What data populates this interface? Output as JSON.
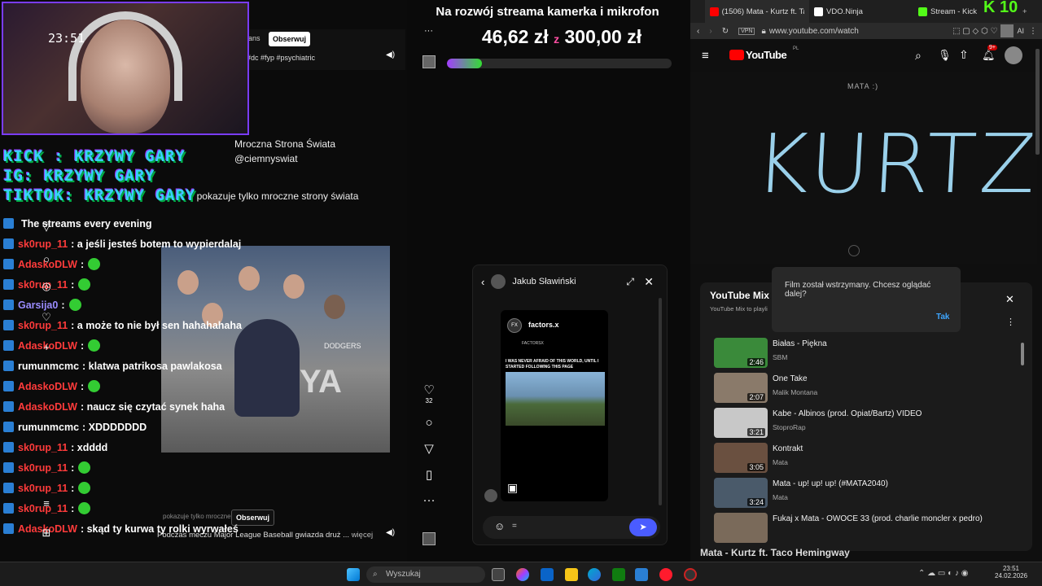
{
  "stream": {
    "webcam_clock": "23:51",
    "socials": [
      "KICK : KRZYWY GARY",
      "IG: KRZYWY GARY",
      "TIKTOK: KRZYWY GARY"
    ],
    "chat": [
      {
        "user": "",
        "text": "The streams every evening",
        "color": "#cccccc"
      },
      {
        "user": "sk0rup_11",
        "text": ": a jeśli jesteś botem to wypierdalaj",
        "color": "#ff3b3b"
      },
      {
        "user": "AdaskoDLW",
        "text": ":",
        "color": "#ff3b3b",
        "emote": true
      },
      {
        "user": "sk0rup_11",
        "text": ":",
        "color": "#ff3b3b",
        "emote": true
      },
      {
        "user": "Garsija0",
        "text": ":",
        "color": "#9a8cff",
        "emote": true
      },
      {
        "user": "sk0rup_11",
        "text": ": a może to nie był sen hahahahaha",
        "color": "#ff3b3b"
      },
      {
        "user": "AdaskoDLW",
        "text": ":",
        "color": "#ff3b3b",
        "emote": true
      },
      {
        "user": "rumunmcmc",
        "text": ": klatwa patrikosa pawlakosa",
        "color": "#ffffff"
      },
      {
        "user": "AdaskoDLW",
        "text": ":",
        "color": "#ff3b3b",
        "emote": true
      },
      {
        "user": "AdaskoDLW",
        "text": ": naucz się czytać synek haha",
        "color": "#ff3b3b"
      },
      {
        "user": "rumunmcmc",
        "text": ": XDDDDDDD",
        "color": "#ffffff"
      },
      {
        "user": "sk0rup_11",
        "text": ": xdddd",
        "color": "#ff3b3b"
      },
      {
        "user": "sk0rup_11",
        "text": ":",
        "color": "#ff3b3b",
        "emote": true
      },
      {
        "user": "sk0rup_11",
        "text": ":",
        "color": "#ff3b3b",
        "emote": true
      },
      {
        "user": "sk0rup_11",
        "text": ":",
        "color": "#ff3b3b",
        "emote": true
      },
      {
        "user": "AdaskoDLW",
        "text": ": skąd ty kurwa ty rolki wyrwałeś",
        "color": "#ff3b3b"
      }
    ]
  },
  "tiktok": {
    "top_partial": "ans",
    "follow_label": "Obserwuj",
    "top_tags": "#dc #fyp #psychiatric",
    "account_name": "Mroczna Strona Świata",
    "account_handle": "@ciemnyswiat",
    "account_bio": "pokazuje tylko mroczne strony świata",
    "video_brand": "DODGERS",
    "video_sign": "YA",
    "likes_count": "32",
    "caption": "Podczas meczu Major League Baseball gwiazda druż ...",
    "more_label": "więcej",
    "bottom_user": "pokazuje tylko mroczne"
  },
  "goal": {
    "title": "Na rozwój streama kamerka i mikrofon",
    "current": "46,62 zł",
    "separator": "z",
    "target": "300,00 zł",
    "progress": 0.155
  },
  "dm": {
    "contact": "Jakub Sławiński",
    "card_brand": "factors.x",
    "card_sub": "FACTORSX",
    "card_text": "I WAS NEVER AFRAID OF THIS WORLD, UNTIL I STARTED FOLLOWING THIS PAGE",
    "input_value": "="
  },
  "browser": {
    "tabs": [
      {
        "label": "(1506) Mata - Kurtz ft. Ta",
        "color": "#ff0000",
        "active": true
      },
      {
        "label": "VDO.Ninja",
        "color": "#ffffff",
        "active": false
      },
      {
        "label": "Stream - Kick",
        "color": "#53fc18",
        "active": false
      }
    ],
    "url": "www.youtube.com/watch",
    "vpn_label": "VPN",
    "ai_label": "AI",
    "yt_logo": "YouTube",
    "yt_region": "PL",
    "notif_count": "9+",
    "video_small_text": "MATA :)",
    "video_big_text": "KURTZ",
    "popup_text": "Film został wstrzymany. Chcesz oglądać dalej?",
    "popup_yes": "Tak",
    "mix_title": "YouTube Mix",
    "mix_sub": "YouTube Mix to playli",
    "mix_items": [
      {
        "title": "Białas - Piękna",
        "channel": "SBM",
        "duration": "2:46",
        "color": "#3a8a3a"
      },
      {
        "title": "One Take",
        "channel": "Malik Montana",
        "duration": "2:07",
        "color": "#8a7a6a"
      },
      {
        "title": "Kabe - Albinos (prod. Opiat/Bartz) VIDEO",
        "channel": "StoproRap",
        "duration": "3:21",
        "color": "#c8c8c8"
      },
      {
        "title": "Kontrakt",
        "channel": "Mata",
        "duration": "3:05",
        "color": "#6a5040"
      },
      {
        "title": "Mata - up! up! up! (#MATA2040)",
        "channel": "Mata",
        "duration": "3:24",
        "color": "#4a5a6a"
      },
      {
        "title": "Fukaj x Mata - OWOCE 33 (prod. charlie moncler x pedro)",
        "channel": "",
        "duration": "",
        "color": "#7a6a5a"
      }
    ],
    "bottom_title": "Mata - Kurtz ft. Taco Hemingway"
  },
  "taskbar": {
    "search_placeholder": "Wyszukaj",
    "time": "23:51",
    "date": "24.02.2026"
  },
  "kick_badge": "K 10"
}
